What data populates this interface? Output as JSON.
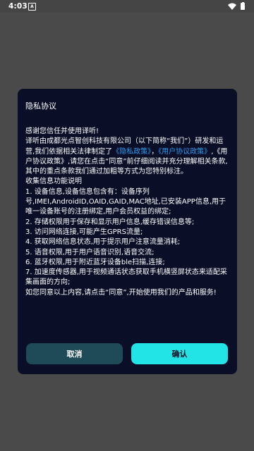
{
  "status_bar": {
    "time": "4:03",
    "notification_icon_letter": "A",
    "icons": [
      "a-notification-icon",
      "wifi-icon",
      "battery-icon"
    ]
  },
  "dialog": {
    "title": "隐私协议",
    "greeting": "感谢您信任并使用译听!",
    "intro_pre": "译听由成都光点智创科技有限公司（以下简称“我们”）研发和运营,我们依据相关法律制定了",
    "privacy_link": "《隐私政策》",
    "intro_sep": "，",
    "agreement_link": "《用户协议政策》",
    "intro_post": ",《用户协议政策》,请您在点击“同意”前仔细阅读并充分理解相关条款,其中的重点条款我们通过加粗等方式为您特别标注。",
    "section_title": "收集信息功能说明",
    "items": [
      "1. 设备信息,设备信息包含有：设备序列号,IMEI,AndroidID,OAID,GAID,MAC地址,已安装APP信息,用于唯一设备账号的注册绑定,用户会员权益的绑定;",
      "2. 存储权限用于保存和显示用户信息,缓存错误信息等;",
      "3. 访问网络连接,可能产生GPRS流量;",
      "4. 获取网络信息状态,用于提示用户注意流量消耗;",
      "5. 语音权限,用于用户语音识别,语音交流;",
      "6. 蓝牙权限,用于附近蓝牙设备ble扫描,连接;",
      "7. 加速度传感器,用于视频通话状态获取手机横竖屏状态来适配采集画面的方向;"
    ],
    "closing": "如您同意以上内容,请点击“同意”,开始使用我们的产品和服务!",
    "cancel_label": "取消",
    "confirm_label": "确认"
  },
  "colors": {
    "overlay": "#4a4a4a",
    "dialog_bg": "#0a0e26",
    "link": "#2d9cf0",
    "cancel_button": "#1f4a58",
    "confirm_button": "#22e4e6"
  }
}
